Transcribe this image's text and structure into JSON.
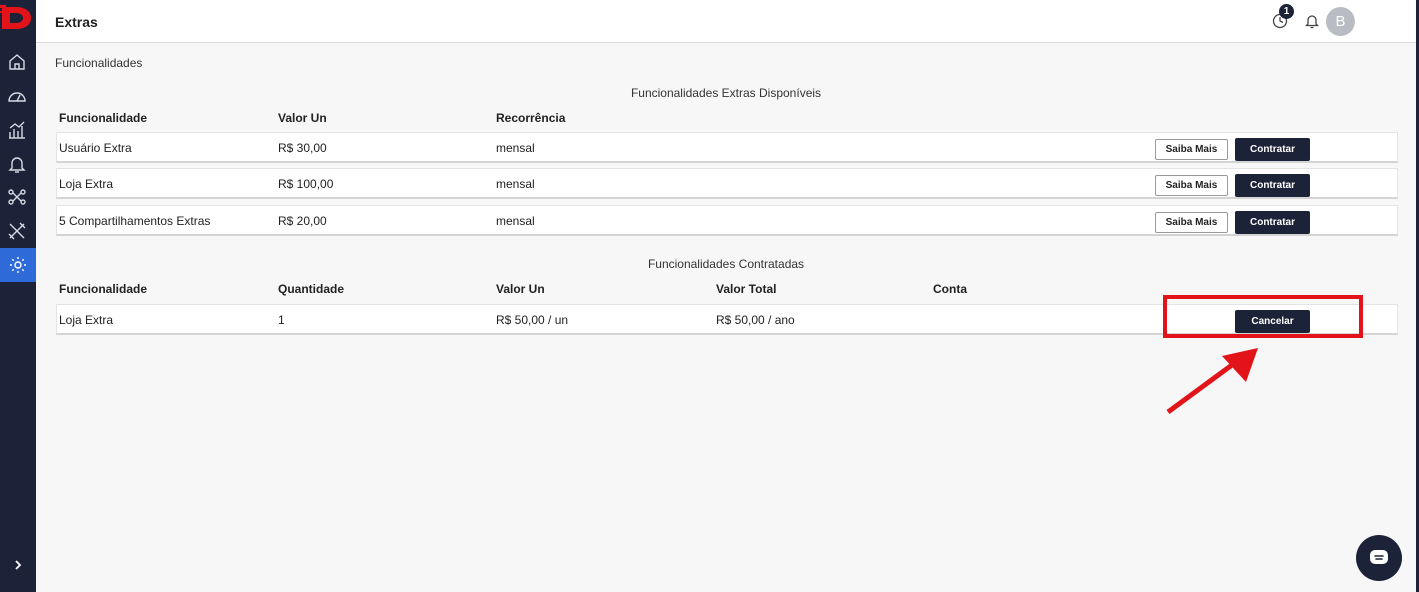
{
  "header": {
    "title": "Extras",
    "notification_count": "1",
    "avatar_initial": "B"
  },
  "sidebar": {
    "items": [
      {
        "name": "home-icon"
      },
      {
        "name": "dashboard-icon"
      },
      {
        "name": "analytics-icon"
      },
      {
        "name": "bell-icon"
      },
      {
        "name": "integrations-icon"
      },
      {
        "name": "tools-icon"
      },
      {
        "name": "settings-icon",
        "active": true
      }
    ],
    "expand_icon": "chevron-right-icon"
  },
  "section_label": "Funcionalidades",
  "available": {
    "caption": "Funcionalidades Extras Disponíveis",
    "columns": [
      "Funcionalidade",
      "Valor Un",
      "Recorrência"
    ],
    "rows": [
      {
        "name": "Usuário Extra",
        "price": "R$ 30,00",
        "recurrence": "mensal"
      },
      {
        "name": "Loja Extra",
        "price": "R$ 100,00",
        "recurrence": "mensal"
      },
      {
        "name": "5 Compartilhamentos Extras",
        "price": "R$ 20,00",
        "recurrence": "mensal"
      }
    ],
    "learn_more_label": "Saiba Mais",
    "hire_label": "Contratar"
  },
  "contracted": {
    "caption": "Funcionalidades Contratadas",
    "columns": [
      "Funcionalidade",
      "Quantidade",
      "Valor Un",
      "Valor Total",
      "Conta"
    ],
    "rows": [
      {
        "name": "Loja Extra",
        "quantity": "1",
        "unit_price": "R$ 50,00 / un",
        "total": "R$ 50,00 / ano",
        "account": ""
      }
    ],
    "cancel_label": "Cancelar"
  },
  "colors": {
    "sidebar": "#1c2238",
    "accent": "#2f6bd8",
    "brand_red": "#e3131a",
    "button_dark": "#1c2238"
  }
}
